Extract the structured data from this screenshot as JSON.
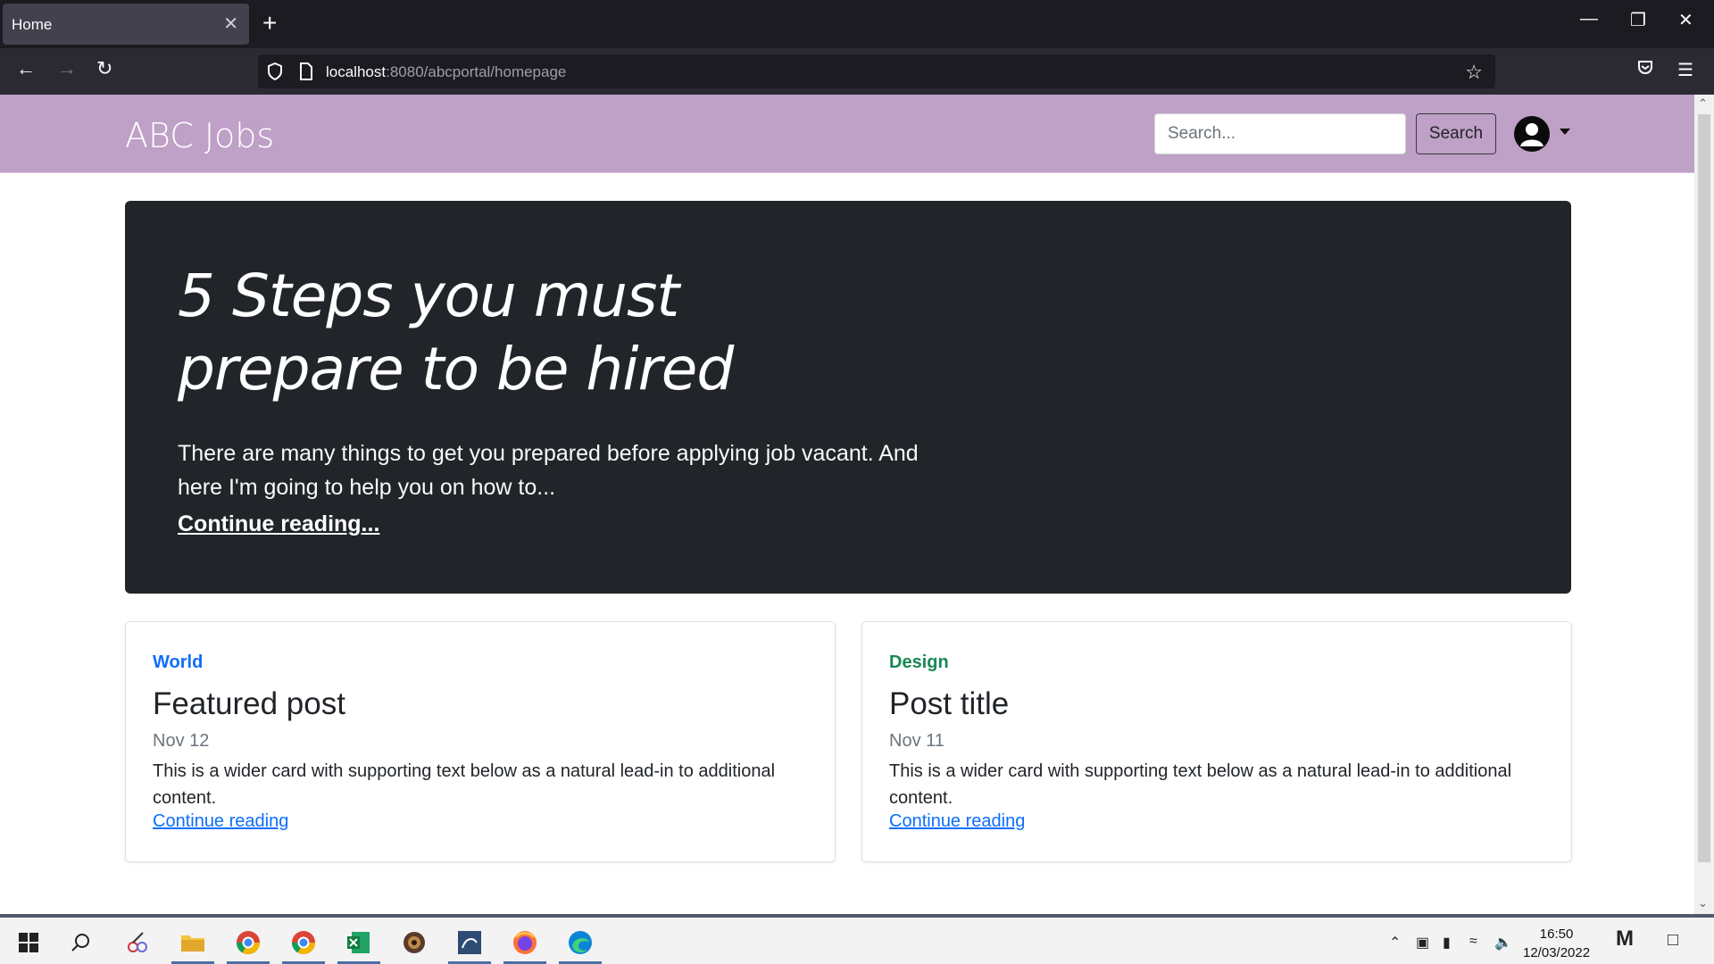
{
  "browser": {
    "tab_title": "Home",
    "tab_close": "✕",
    "new_tab": "+",
    "url_host": "localhost",
    "url_rest": ":8080/abcportal/homepage"
  },
  "site": {
    "brand": "ABC Jobs",
    "search_placeholder": "Search...",
    "search_button": "Search"
  },
  "hero": {
    "title": "5 Steps you must prepare to be hired",
    "text": "There are many things to get you prepared before applying job vacant. And here I'm going to help you on how to...",
    "link": "Continue reading..."
  },
  "cards": [
    {
      "category": "World",
      "category_color": "#0d6efd",
      "title": "Featured post",
      "date": "Nov 12",
      "text": "This is a wider card with supporting text below as a natural lead-in to additional content.",
      "link": "Continue reading"
    },
    {
      "category": "Design",
      "category_color": "#198754",
      "title": "Post title",
      "date": "Nov 11",
      "text": "This is a wider card with supporting text below as a natural lead-in to additional content.",
      "link": "Continue reading"
    }
  ],
  "taskbar": {
    "time": "16:50",
    "date": "12/03/2022"
  },
  "colors": {
    "header_bg": "#bfa0c6",
    "hero_bg": "#212529",
    "link": "#0d6efd"
  }
}
